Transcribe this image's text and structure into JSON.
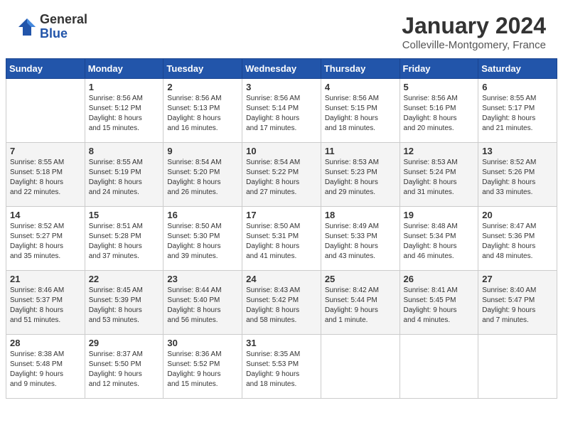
{
  "header": {
    "logo": {
      "general": "General",
      "blue": "Blue"
    },
    "title": "January 2024",
    "subtitle": "Colleville-Montgomery, France"
  },
  "weekdays": [
    "Sunday",
    "Monday",
    "Tuesday",
    "Wednesday",
    "Thursday",
    "Friday",
    "Saturday"
  ],
  "weeks": [
    [
      {
        "day": "",
        "info": ""
      },
      {
        "day": "1",
        "info": "Sunrise: 8:56 AM\nSunset: 5:12 PM\nDaylight: 8 hours\nand 15 minutes."
      },
      {
        "day": "2",
        "info": "Sunrise: 8:56 AM\nSunset: 5:13 PM\nDaylight: 8 hours\nand 16 minutes."
      },
      {
        "day": "3",
        "info": "Sunrise: 8:56 AM\nSunset: 5:14 PM\nDaylight: 8 hours\nand 17 minutes."
      },
      {
        "day": "4",
        "info": "Sunrise: 8:56 AM\nSunset: 5:15 PM\nDaylight: 8 hours\nand 18 minutes."
      },
      {
        "day": "5",
        "info": "Sunrise: 8:56 AM\nSunset: 5:16 PM\nDaylight: 8 hours\nand 20 minutes."
      },
      {
        "day": "6",
        "info": "Sunrise: 8:55 AM\nSunset: 5:17 PM\nDaylight: 8 hours\nand 21 minutes."
      }
    ],
    [
      {
        "day": "7",
        "info": "Sunrise: 8:55 AM\nSunset: 5:18 PM\nDaylight: 8 hours\nand 22 minutes."
      },
      {
        "day": "8",
        "info": "Sunrise: 8:55 AM\nSunset: 5:19 PM\nDaylight: 8 hours\nand 24 minutes."
      },
      {
        "day": "9",
        "info": "Sunrise: 8:54 AM\nSunset: 5:20 PM\nDaylight: 8 hours\nand 26 minutes."
      },
      {
        "day": "10",
        "info": "Sunrise: 8:54 AM\nSunset: 5:22 PM\nDaylight: 8 hours\nand 27 minutes."
      },
      {
        "day": "11",
        "info": "Sunrise: 8:53 AM\nSunset: 5:23 PM\nDaylight: 8 hours\nand 29 minutes."
      },
      {
        "day": "12",
        "info": "Sunrise: 8:53 AM\nSunset: 5:24 PM\nDaylight: 8 hours\nand 31 minutes."
      },
      {
        "day": "13",
        "info": "Sunrise: 8:52 AM\nSunset: 5:26 PM\nDaylight: 8 hours\nand 33 minutes."
      }
    ],
    [
      {
        "day": "14",
        "info": "Sunrise: 8:52 AM\nSunset: 5:27 PM\nDaylight: 8 hours\nand 35 minutes."
      },
      {
        "day": "15",
        "info": "Sunrise: 8:51 AM\nSunset: 5:28 PM\nDaylight: 8 hours\nand 37 minutes."
      },
      {
        "day": "16",
        "info": "Sunrise: 8:50 AM\nSunset: 5:30 PM\nDaylight: 8 hours\nand 39 minutes."
      },
      {
        "day": "17",
        "info": "Sunrise: 8:50 AM\nSunset: 5:31 PM\nDaylight: 8 hours\nand 41 minutes."
      },
      {
        "day": "18",
        "info": "Sunrise: 8:49 AM\nSunset: 5:33 PM\nDaylight: 8 hours\nand 43 minutes."
      },
      {
        "day": "19",
        "info": "Sunrise: 8:48 AM\nSunset: 5:34 PM\nDaylight: 8 hours\nand 46 minutes."
      },
      {
        "day": "20",
        "info": "Sunrise: 8:47 AM\nSunset: 5:36 PM\nDaylight: 8 hours\nand 48 minutes."
      }
    ],
    [
      {
        "day": "21",
        "info": "Sunrise: 8:46 AM\nSunset: 5:37 PM\nDaylight: 8 hours\nand 51 minutes."
      },
      {
        "day": "22",
        "info": "Sunrise: 8:45 AM\nSunset: 5:39 PM\nDaylight: 8 hours\nand 53 minutes."
      },
      {
        "day": "23",
        "info": "Sunrise: 8:44 AM\nSunset: 5:40 PM\nDaylight: 8 hours\nand 56 minutes."
      },
      {
        "day": "24",
        "info": "Sunrise: 8:43 AM\nSunset: 5:42 PM\nDaylight: 8 hours\nand 58 minutes."
      },
      {
        "day": "25",
        "info": "Sunrise: 8:42 AM\nSunset: 5:44 PM\nDaylight: 9 hours\nand 1 minute."
      },
      {
        "day": "26",
        "info": "Sunrise: 8:41 AM\nSunset: 5:45 PM\nDaylight: 9 hours\nand 4 minutes."
      },
      {
        "day": "27",
        "info": "Sunrise: 8:40 AM\nSunset: 5:47 PM\nDaylight: 9 hours\nand 7 minutes."
      }
    ],
    [
      {
        "day": "28",
        "info": "Sunrise: 8:38 AM\nSunset: 5:48 PM\nDaylight: 9 hours\nand 9 minutes."
      },
      {
        "day": "29",
        "info": "Sunrise: 8:37 AM\nSunset: 5:50 PM\nDaylight: 9 hours\nand 12 minutes."
      },
      {
        "day": "30",
        "info": "Sunrise: 8:36 AM\nSunset: 5:52 PM\nDaylight: 9 hours\nand 15 minutes."
      },
      {
        "day": "31",
        "info": "Sunrise: 8:35 AM\nSunset: 5:53 PM\nDaylight: 9 hours\nand 18 minutes."
      },
      {
        "day": "",
        "info": ""
      },
      {
        "day": "",
        "info": ""
      },
      {
        "day": "",
        "info": ""
      }
    ]
  ]
}
